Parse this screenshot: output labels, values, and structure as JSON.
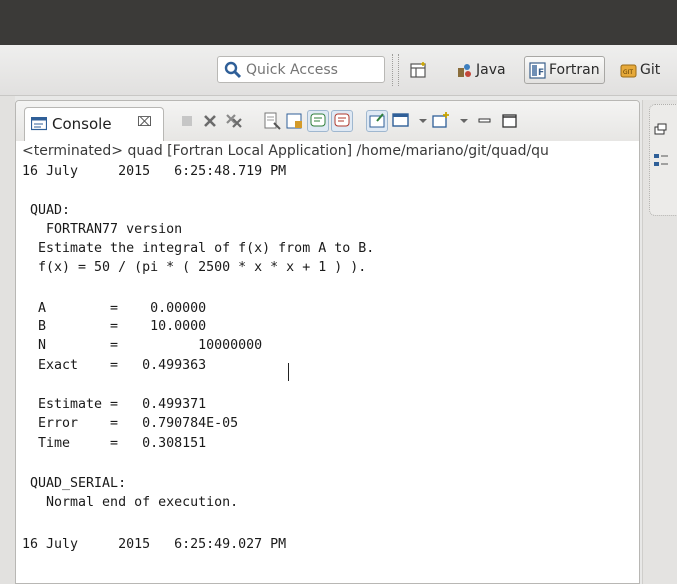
{
  "toolbar": {
    "quick_access_placeholder": "Quick Access",
    "perspectives": [
      {
        "label": "Java",
        "active": false
      },
      {
        "label": "Fortran",
        "active": true
      },
      {
        "label": "Git",
        "active": false
      }
    ]
  },
  "console": {
    "tab_label": "Console",
    "tab_close": "⌧",
    "status": "<terminated> quad [Fortran Local Application] /home/mariano/git/quad/qu",
    "lines": [
      "16 July     2015   6:25:48.719 PM",
      "",
      " QUAD:",
      "   FORTRAN77 version",
      "  Estimate the integral of f(x) from A to B.",
      "  f(x) = 50 / (pi * ( 2500 * x * x + 1 ) ).",
      "",
      "  A        =    0.00000",
      "  B        =    10.0000",
      "  N        =          10000000",
      "  Exact    =   0.499363",
      "",
      "  Estimate =   0.499371",
      "  Error    =   0.790784E-05",
      "  Time     =   0.308151",
      "",
      " QUAD_SERIAL:",
      "   Normal end of execution.",
      "",
      "16 July     2015   6:25:49.027 PM"
    ]
  },
  "colors": {
    "titlebar": "#3b3a38",
    "console_text": "#1a1a1a",
    "accent_blue": "#2f5f98"
  }
}
